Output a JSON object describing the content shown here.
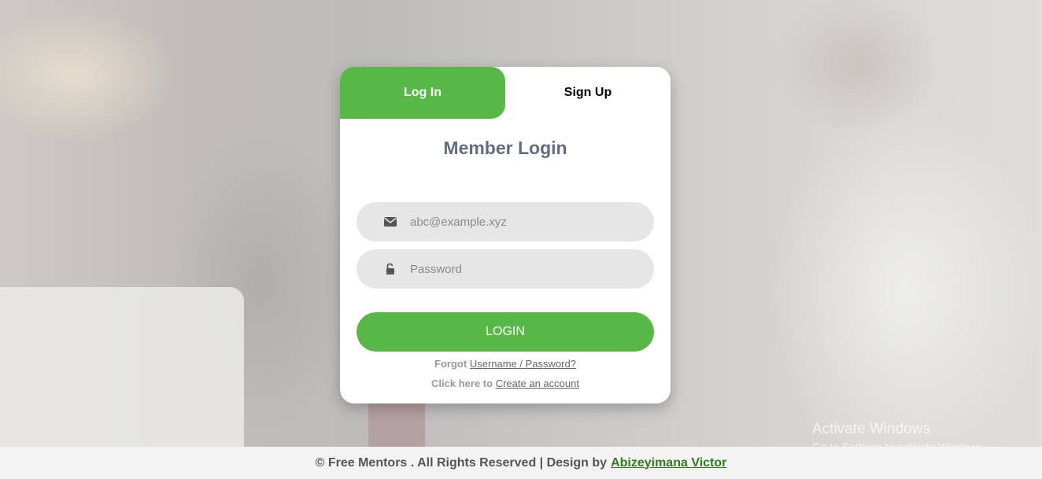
{
  "tabs": {
    "login": "Log In",
    "signup": "Sign Up"
  },
  "form": {
    "title": "Member Login",
    "email_placeholder": "abc@example.xyz",
    "password_placeholder": "Password",
    "login_button": "LOGIN",
    "forgot_prefix": "Forgot",
    "forgot_link": "Username / Password?",
    "create_prefix": "Click here to",
    "create_link": "Create an account"
  },
  "footer": {
    "text": "© Free Mentors . All Rights Reserved | Design by",
    "author_link": "Abizeyimana Victor"
  },
  "watermark": {
    "line1": "Activate Windows",
    "line2": "Go to Settings to activate Windows."
  },
  "colors": {
    "accent": "#58b847",
    "title": "#666b85",
    "field_bg": "#e6e6e6"
  },
  "icons": {
    "email": "envelope-icon",
    "password": "unlock-icon"
  }
}
